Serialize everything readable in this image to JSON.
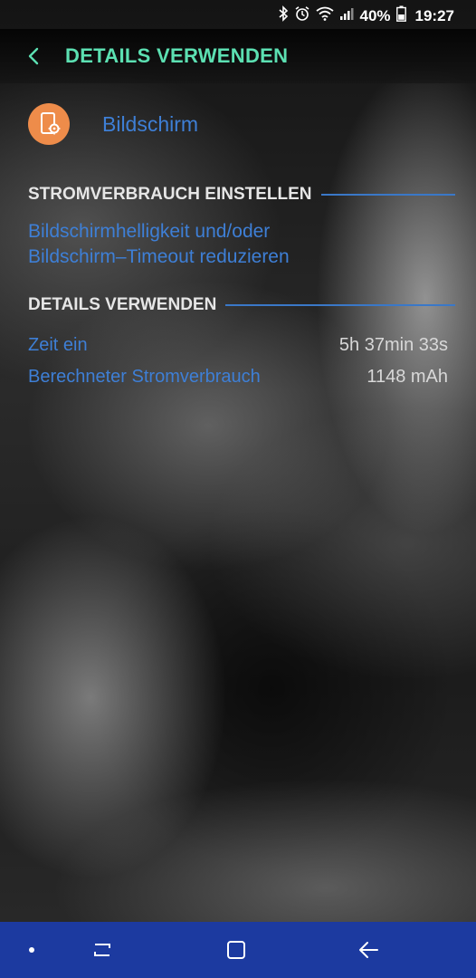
{
  "status_bar": {
    "battery": "40%",
    "time": "19:27",
    "icons": [
      "bluetooth-icon",
      "alarm-icon",
      "wifi-icon",
      "signal-icon",
      "battery-icon"
    ]
  },
  "header": {
    "title": "DETAILS VERWENDEN",
    "title_color": "#5ce0b2",
    "back_icon": "chevron-left-icon"
  },
  "app": {
    "name": "Bildschirm",
    "icon": "screen-settings-icon",
    "icon_bg": "#ee8c4a"
  },
  "sections": {
    "power": {
      "title": "STROMVERBRAUCH EINSTELLEN",
      "tip_line1": "Bildschirmhelligkeit und/oder",
      "tip_line2": "Bildschirm–Timeout reduzieren"
    },
    "details": {
      "title": "DETAILS VERWENDEN",
      "rows": [
        {
          "label": "Zeit ein",
          "value": "5h 37min 33s"
        },
        {
          "label": "Berechneter Stromverbrauch",
          "value": "1148 mAh"
        }
      ]
    }
  },
  "nav_bar": {
    "color": "#1c3aa0",
    "items": [
      "dot-icon",
      "recents-icon",
      "home-icon",
      "back-arrow-icon"
    ]
  }
}
